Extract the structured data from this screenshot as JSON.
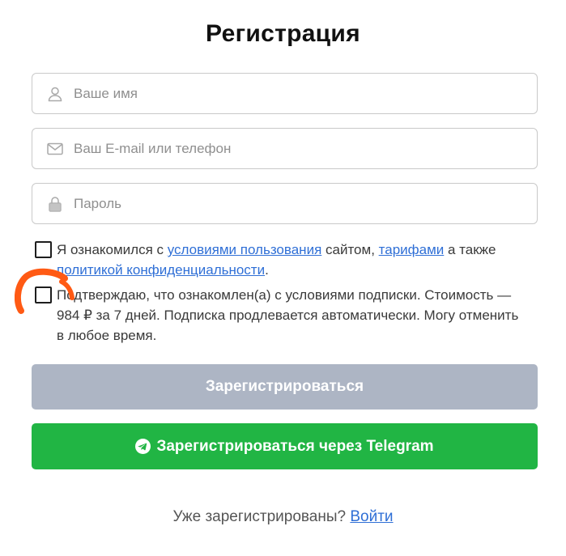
{
  "title": "Регистрация",
  "fields": {
    "name": {
      "placeholder": "Ваше имя",
      "icon": "user-icon"
    },
    "contact": {
      "placeholder": "Ваш E-mail или телефон",
      "icon": "envelope-icon"
    },
    "password": {
      "placeholder": "Пароль",
      "icon": "lock-icon"
    }
  },
  "terms": {
    "t1": "Я ознакомился с ",
    "link_terms": "условиями пользования",
    "t2": " сайтом, ",
    "link_tariffs": "тарифами",
    "t3": " а также ",
    "link_privacy": "политикой конфиденциальности",
    "t4": "."
  },
  "subscription": {
    "text": "Подтверждаю, что ознакомлен(а) с условиями подписки. Стоимость — 984 ₽ за 7 дней. Подписка продлевается автоматически. Могу отменить в любое время."
  },
  "buttons": {
    "register": "Зарегистрироваться",
    "telegram": "Зарегистрироваться через Telegram"
  },
  "footer": {
    "question": "Уже зарегистрированы? ",
    "login": "Войти"
  },
  "colors": {
    "accent_link": "#2f6fd6",
    "register_disabled": "#adb5c4",
    "telegram_green": "#21b544",
    "annotation_orange": "#ff5a14"
  }
}
